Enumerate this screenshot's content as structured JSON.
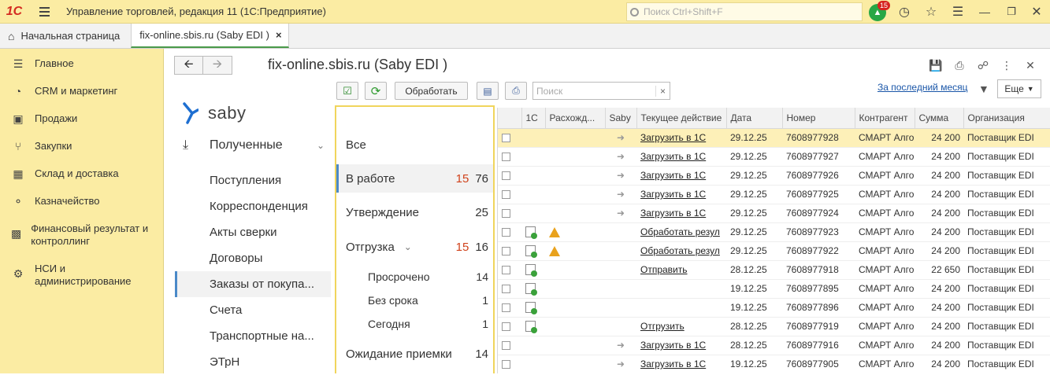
{
  "app": {
    "logo": "1С",
    "title": "Управление торговлей, редакция 11  (1С:Предприятие)",
    "search_placeholder": "Поиск Ctrl+Shift+F",
    "notifications_count": "15"
  },
  "tabs": {
    "home": "Начальная страница",
    "active": "fix-online.sbis.ru (Saby EDI )",
    "close": "×"
  },
  "sidebar": {
    "items": [
      {
        "label": "Главное",
        "icon": "list-icon"
      },
      {
        "label": "CRM и маркетинг",
        "icon": "pie-chart-icon"
      },
      {
        "label": "Продажи",
        "icon": "shopping-bag-icon"
      },
      {
        "label": "Закупки",
        "icon": "cart-icon"
      },
      {
        "label": "Склад и доставка",
        "icon": "warehouse-icon"
      },
      {
        "label": "Казначейство",
        "icon": "coins-icon"
      },
      {
        "label": "Финансовый результат и контроллинг",
        "icon": "bar-chart-icon"
      },
      {
        "label": "НСИ и администрирование",
        "icon": "gear-icon"
      }
    ]
  },
  "page": {
    "title": "fix-online.sbis.ru (Saby EDI )"
  },
  "saby": {
    "logo_text": "saby",
    "section": "Полученные",
    "menu": [
      "Поступления",
      "Корреспонденция",
      "Акты сверки",
      "Договоры",
      "Заказы от покупа...",
      "Счета",
      "Транспортные на...",
      "ЭТрН"
    ],
    "selected_index": 4
  },
  "toolbar": {
    "process_label": "Обработать",
    "search_placeholder": "Поиск",
    "clear": "×",
    "period_link": "За последний месяц",
    "more_label": "Еще"
  },
  "statuses": [
    {
      "label": "Все",
      "red": "",
      "count": ""
    },
    {
      "label": "В работе",
      "red": "15",
      "count": "76"
    },
    {
      "label": "Утверждение",
      "red": "",
      "count": "25"
    },
    {
      "label": "Отгрузка",
      "red": "15",
      "count": "16"
    },
    {
      "label": "Просрочено",
      "red": "",
      "count": "14"
    },
    {
      "label": "Без срока",
      "red": "",
      "count": "1"
    },
    {
      "label": "Сегодня",
      "red": "",
      "count": "1"
    },
    {
      "label": "Ожидание приемки",
      "red": "",
      "count": "14"
    }
  ],
  "table": {
    "columns": [
      "",
      "1С",
      "Расхожд...",
      "Saby",
      "Текущее действие",
      "Дата",
      "Номер",
      "Контрагент",
      "Сумма",
      "Организация"
    ],
    "rows": [
      {
        "doc": false,
        "warn": false,
        "arrow": true,
        "action": "Загрузить в 1С",
        "date": "29.12.25",
        "number": "7608977928",
        "partner": "СМАРТ Алго",
        "sum": "24 200",
        "org": "Поставщик EDI"
      },
      {
        "doc": false,
        "warn": false,
        "arrow": true,
        "action": "Загрузить в 1С",
        "date": "29.12.25",
        "number": "7608977927",
        "partner": "СМАРТ Алго",
        "sum": "24 200",
        "org": "Поставщик EDI"
      },
      {
        "doc": false,
        "warn": false,
        "arrow": true,
        "action": "Загрузить в 1С",
        "date": "29.12.25",
        "number": "7608977926",
        "partner": "СМАРТ Алго",
        "sum": "24 200",
        "org": "Поставщик EDI"
      },
      {
        "doc": false,
        "warn": false,
        "arrow": true,
        "action": "Загрузить в 1С",
        "date": "29.12.25",
        "number": "7608977925",
        "partner": "СМАРТ Алго",
        "sum": "24 200",
        "org": "Поставщик EDI"
      },
      {
        "doc": false,
        "warn": false,
        "arrow": true,
        "action": "Загрузить в 1С",
        "date": "29.12.25",
        "number": "7608977924",
        "partner": "СМАРТ Алго",
        "sum": "24 200",
        "org": "Поставщик EDI"
      },
      {
        "doc": true,
        "warn": true,
        "arrow": false,
        "action": "Обработать резул",
        "date": "29.12.25",
        "number": "7608977923",
        "partner": "СМАРТ Алго",
        "sum": "24 200",
        "org": "Поставщик EDI"
      },
      {
        "doc": true,
        "warn": true,
        "arrow": false,
        "action": "Обработать резул",
        "date": "29.12.25",
        "number": "7608977922",
        "partner": "СМАРТ Алго",
        "sum": "24 200",
        "org": "Поставщик EDI"
      },
      {
        "doc": true,
        "warn": false,
        "arrow": false,
        "action": "Отправить",
        "date": "28.12.25",
        "number": "7608977918",
        "partner": "СМАРТ Алго",
        "sum": "22 650",
        "org": "Поставщик EDI"
      },
      {
        "doc": true,
        "warn": false,
        "arrow": false,
        "action": "",
        "date": "19.12.25",
        "number": "7608977895",
        "partner": "СМАРТ Алго",
        "sum": "24 200",
        "org": "Поставщик EDI"
      },
      {
        "doc": true,
        "warn": false,
        "arrow": false,
        "action": "",
        "date": "19.12.25",
        "number": "7608977896",
        "partner": "СМАРТ Алго",
        "sum": "24 200",
        "org": "Поставщик EDI"
      },
      {
        "doc": true,
        "warn": false,
        "arrow": false,
        "action": "Отгрузить",
        "date": "28.12.25",
        "number": "7608977919",
        "partner": "СМАРТ Алго",
        "sum": "24 200",
        "org": "Поставщик EDI"
      },
      {
        "doc": false,
        "warn": false,
        "arrow": true,
        "action": "Загрузить в 1С",
        "date": "28.12.25",
        "number": "7608977916",
        "partner": "СМАРТ Алго",
        "sum": "24 200",
        "org": "Поставщик EDI"
      },
      {
        "doc": false,
        "warn": false,
        "arrow": true,
        "action": "Загрузить в 1С",
        "date": "19.12.25",
        "number": "7608977905",
        "partner": "СМАРТ Алго",
        "sum": "24 200",
        "org": "Поставщик EDI"
      }
    ]
  }
}
